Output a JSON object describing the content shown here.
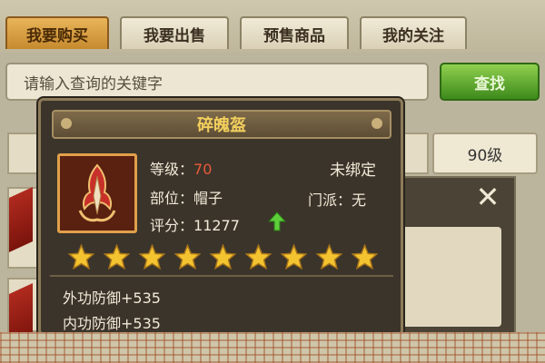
{
  "tabs": [
    {
      "label": "我要购买",
      "active": true
    },
    {
      "label": "我要出售",
      "active": false
    },
    {
      "label": "预售商品",
      "active": false
    },
    {
      "label": "我的关注",
      "active": false
    }
  ],
  "search": {
    "placeholder": "请输入查询的关键字",
    "button_label": "查找"
  },
  "list": {
    "level_label": "90级"
  },
  "tooltip": {
    "item_name": "碎魄盔",
    "level_label": "等级：",
    "level_value": "70",
    "bind_status": "未绑定",
    "slot_label": "部位：",
    "slot_value": "帽子",
    "sect_label": "门派：",
    "sect_value": "无",
    "score_label": "评分：",
    "score_value": "11277",
    "score_trend": "up",
    "stars": 9,
    "attributes": [
      "外功防御+535",
      "内功防御+535"
    ]
  },
  "icons": {
    "close": "close-icon",
    "item": "helmet-icon",
    "star": "star-icon",
    "arrow": "up-arrow-icon"
  },
  "colors": {
    "item_name": "#f2cf5d",
    "level_value": "#e85a3a",
    "active_tab": "#c78a2e",
    "search_button": "#3d8a1b"
  }
}
